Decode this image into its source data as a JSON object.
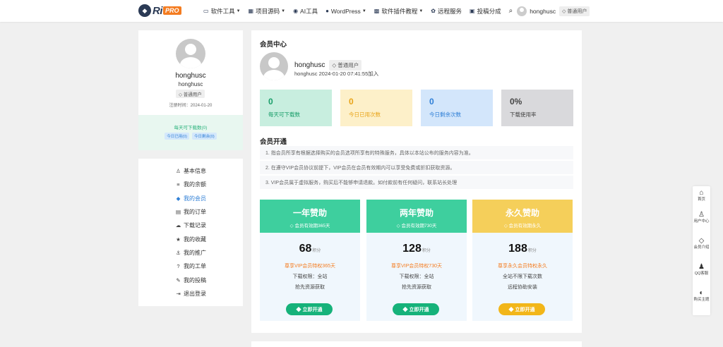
{
  "header": {
    "logo": {
      "mark": "◆",
      "text": "Ri",
      "badge": "PRO"
    },
    "nav": [
      {
        "icon": "▭",
        "label": "软件工具",
        "chevron": true
      },
      {
        "icon": "▦",
        "label": "项目源码",
        "chevron": true
      },
      {
        "icon": "◉",
        "label": "AI工具",
        "chevron": false
      },
      {
        "icon": "●",
        "label": "WordPress",
        "chevron": true
      },
      {
        "icon": "▩",
        "label": "软件插件教程",
        "chevron": true
      },
      {
        "icon": "✿",
        "label": "远程服务",
        "chevron": false
      },
      {
        "icon": "▣",
        "label": "投稿分成",
        "chevron": false
      }
    ],
    "search_icon": "⌕",
    "username": "honghusc",
    "user_badge": "◇ 普通用户"
  },
  "profile": {
    "name": "honghusc",
    "name2": "honghusc",
    "badge": "◇ 普通用户",
    "register": "注册时间：2024-01-20",
    "download_title": "每天可下载数(0)",
    "used_tag": "今日已用(0)",
    "left_tag": "今日剩余(0)"
  },
  "menu": [
    {
      "icon": "♙",
      "label": "基本信息",
      "active": false
    },
    {
      "icon": "≡",
      "label": "我的余额",
      "active": false
    },
    {
      "icon": "◆",
      "label": "我的会员",
      "active": true
    },
    {
      "icon": "▤",
      "label": "我的订单",
      "active": false
    },
    {
      "icon": "☁",
      "label": "下载记录",
      "active": false
    },
    {
      "icon": "★",
      "label": "我的收藏",
      "active": false
    },
    {
      "icon": "⚓",
      "label": "我的推广",
      "active": false
    },
    {
      "icon": "?",
      "label": "我的工单",
      "active": false
    },
    {
      "icon": "✎",
      "label": "我的投稿",
      "active": false
    },
    {
      "icon": "⇥",
      "label": "退出登录",
      "active": false
    }
  ],
  "main": {
    "center_title": "会员中心",
    "user_name": "honghusc",
    "user_badge": "◇ 普通用户",
    "join_text": "honghusc 2024-01-20 07:41:55加入",
    "stats": [
      {
        "value": "0",
        "label": "每天可下载数",
        "bg": "#c8eedf",
        "color": "#1a9e6a"
      },
      {
        "value": "0",
        "label": "今日已用次数",
        "bg": "#fdf0c9",
        "color": "#e8a317"
      },
      {
        "value": "0",
        "label": "今日剩余次数",
        "bg": "#d3e6fb",
        "color": "#2f7fd6"
      },
      {
        "value": "0%",
        "label": "下载使用率",
        "bg": "#d9d9dc",
        "color": "#444444"
      }
    ],
    "open_title": "会员开通",
    "notices": [
      "1. 指会员所享有根据选择购买的会员选项所享有的特殊服务，具体以本站公布的服务内容为准。",
      "2. 在遵守VIP会员协议前提下，VIP会员在会员有效期内可以享受免费或折扣获取资源。",
      "3. VIP会员属于虚拟服务，购买后不能够申请退款。如付款前有任何疑问，联系站长处理"
    ],
    "plans": [
      {
        "title": "一年赞助",
        "sub": "◇ 会员有效期365天",
        "price": "68",
        "unit": "积分",
        "highlight": "尊享VIP会员特权365天",
        "line1": "下载权限：全站",
        "line2": "抢先资源获取",
        "button": "◆ 立即开通",
        "head_color": "#3ecf9e",
        "btn_color": "#16b27a"
      },
      {
        "title": "两年赞助",
        "sub": "◇ 会员有效期730天",
        "price": "128",
        "unit": "积分",
        "highlight": "尊享VIP会员特权730天",
        "line1": "下载权限：全站",
        "line2": "抢先资源获取",
        "button": "◆ 立即开通",
        "head_color": "#3ecf9e",
        "btn_color": "#16b27a"
      },
      {
        "title": "永久赞助",
        "sub": "◇ 会员有效期永久",
        "price": "188",
        "unit": "积分",
        "highlight": "尊享永久会员特权永久",
        "line1": "全站不限下载次数",
        "line2": "远程协助安装",
        "button": "◆ 立即开通",
        "head_color": "#f5cf5a",
        "btn_color": "#f2b619"
      }
    ]
  },
  "float_bar": [
    {
      "icon": "⌂",
      "label": "首页"
    },
    {
      "icon": "♙",
      "label": "用户中心"
    },
    {
      "icon": "◇",
      "label": "会员介绍"
    },
    {
      "icon": "♟",
      "label": "QQ客服"
    },
    {
      "icon": "◐",
      "label": "购买主题"
    }
  ]
}
